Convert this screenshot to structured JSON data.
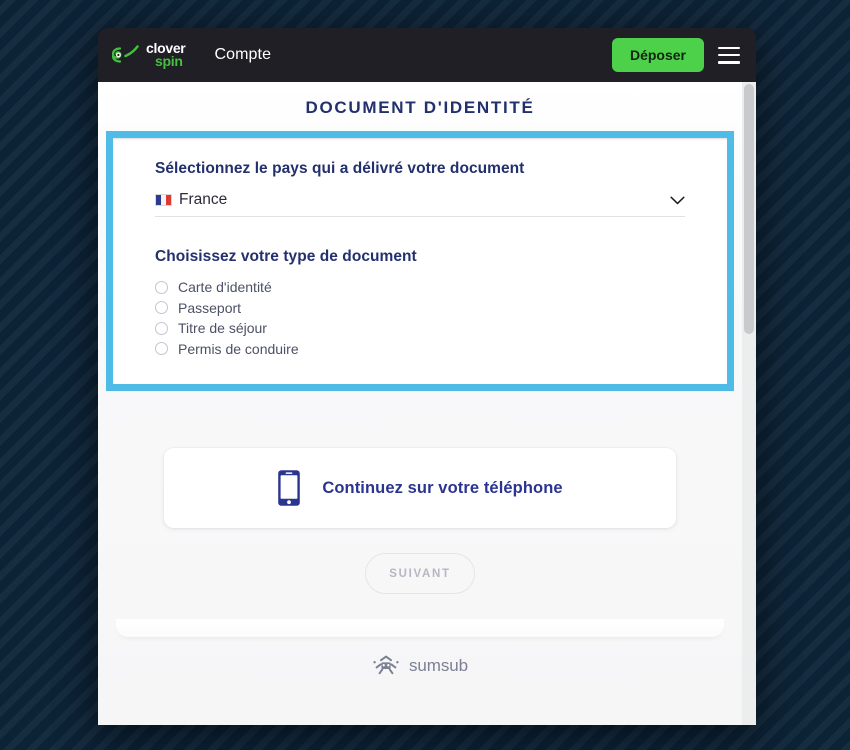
{
  "site": {
    "brand_top": "clover",
    "brand_bottom": "spin",
    "brand_icon": "clover-leaf-icon",
    "nav_account": "Compte",
    "deposit_label": "Déposer",
    "menu_icon": "hamburger-menu-icon",
    "colors": {
      "topbar_bg": "#201f25",
      "deposit_green": "#4ed14a",
      "brand_green": "#43c13e",
      "page_bg": "#0d2438"
    }
  },
  "kyc": {
    "title": "DOCUMENT D'IDENTITÉ",
    "title_color": "#23306e",
    "highlight_color": "#4fbce8",
    "country": {
      "label": "Sélectionnez le pays qui a délivré votre document",
      "flag_icon": "france-flag-icon",
      "flag": "🇫🇷",
      "value": "France",
      "chevron_icon": "chevron-down-icon"
    },
    "doctype": {
      "label": "Choisissez votre type de document",
      "selected": null,
      "options": [
        {
          "label": "Carte d'identité",
          "checked": false
        },
        {
          "label": "Passeport",
          "checked": false
        },
        {
          "label": "Titre de séjour",
          "checked": false
        },
        {
          "label": "Permis de conduire",
          "checked": false
        }
      ]
    },
    "phone_card": {
      "icon": "mobile-phone-icon",
      "label": "Continuez sur votre téléphone"
    },
    "next_button": {
      "label": "SUIVANT",
      "enabled": false
    },
    "footer": {
      "icon": "sumsub-logo-icon",
      "brand": "sumsub"
    }
  }
}
